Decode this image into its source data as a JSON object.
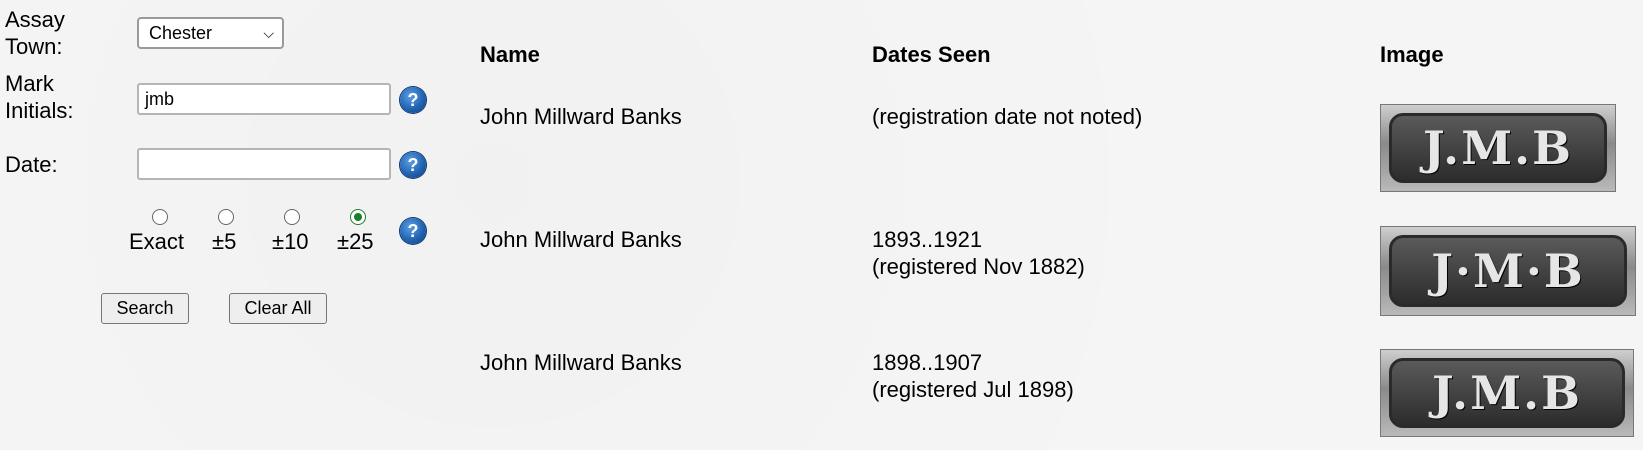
{
  "form": {
    "assay_town_label": "Assay Town:",
    "assay_town_value": "Chester",
    "mark_initials_label": "Mark Initials:",
    "mark_initials_value": "jmb",
    "date_label": "Date:",
    "date_value": "",
    "tolerance_options": [
      {
        "label": "Exact",
        "selected": false
      },
      {
        "label": "±5",
        "selected": false
      },
      {
        "label": "±10",
        "selected": false
      },
      {
        "label": "±25",
        "selected": true
      }
    ],
    "help_symbol": "?",
    "search_label": "Search",
    "clear_label": "Clear All"
  },
  "results": {
    "headers": {
      "name": "Name",
      "dates": "Dates Seen",
      "image": "Image"
    },
    "rows": [
      {
        "name": "John Millward Banks",
        "dates_line1": "(registration date not noted)",
        "dates_line2": "",
        "mark_text": "J.M.B"
      },
      {
        "name": "John Millward Banks",
        "dates_line1": "1893..1921",
        "dates_line2": "(registered Nov 1882)",
        "mark_text": "J·M·B"
      },
      {
        "name": "John Millward Banks",
        "dates_line1": "1898..1907",
        "dates_line2": "(registered Jul 1898)",
        "mark_text": "J.M.B"
      }
    ]
  },
  "icons": {
    "help": "help-question-icon",
    "dropdown": "chevron-down-icon"
  },
  "colors": {
    "help_icon": "#1f5fae",
    "radio_selected": "#1a7f2a"
  }
}
